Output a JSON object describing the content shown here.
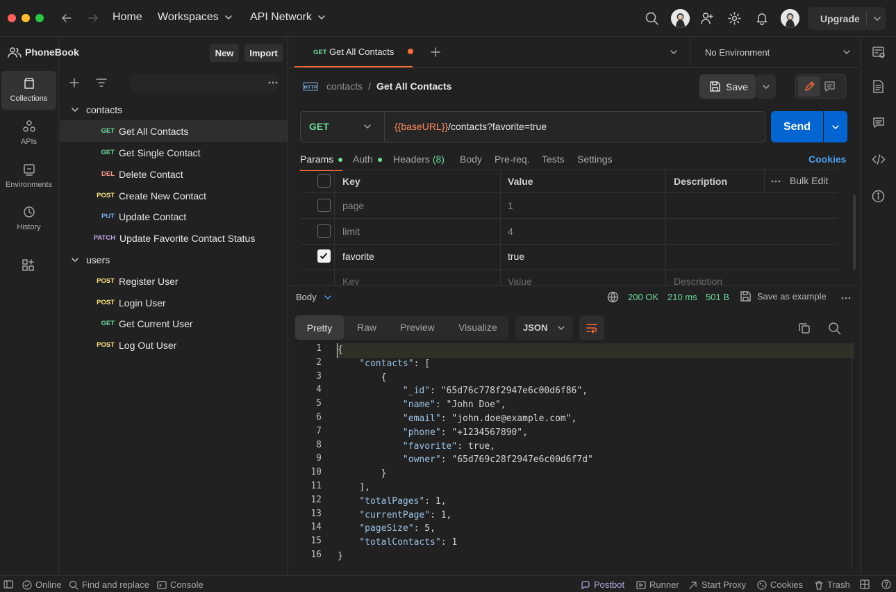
{
  "topbar": {
    "home": "Home",
    "workspaces": "Workspaces",
    "api_network": "API Network",
    "upgrade": "Upgrade"
  },
  "workspace": {
    "name": "PhoneBook",
    "new_label": "New",
    "import_label": "Import"
  },
  "rail": [
    {
      "label": "Collections",
      "icon": "collections-icon"
    },
    {
      "label": "APIs",
      "icon": "apis-icon"
    },
    {
      "label": "Environments",
      "icon": "environments-icon"
    },
    {
      "label": "History",
      "icon": "history-icon"
    }
  ],
  "tree": {
    "folders": [
      {
        "name": "contacts",
        "requests": [
          {
            "method": "GET",
            "name": "Get All Contacts"
          },
          {
            "method": "GET",
            "name": "Get Single Contact"
          },
          {
            "method": "DEL",
            "name": "Delete Contact"
          },
          {
            "method": "POST",
            "name": "Create New Contact"
          },
          {
            "method": "PUT",
            "name": "Update Contact"
          },
          {
            "method": "PATCH",
            "name": "Update Favorite Contact Status"
          }
        ]
      },
      {
        "name": "users",
        "requests": [
          {
            "method": "POST",
            "name": "Register User"
          },
          {
            "method": "POST",
            "name": "Login User"
          },
          {
            "method": "GET",
            "name": "Get Current User"
          },
          {
            "method": "POST",
            "name": "Log Out User"
          }
        ]
      }
    ]
  },
  "tab": {
    "method": "GET",
    "name": "Get All Contacts"
  },
  "environment": "No Environment",
  "breadcrumb": {
    "folder": "contacts",
    "sep": "/",
    "request": "Get All Contacts"
  },
  "save_label": "Save",
  "request": {
    "method": "GET",
    "url_var": "{{baseURL}}",
    "url_path": "/contacts?favorite=true",
    "send_label": "Send"
  },
  "param_tabs": {
    "params": "Params",
    "auth": "Auth",
    "headers": "Headers",
    "headers_count": "(8)",
    "body": "Body",
    "prereq": "Pre-req.",
    "tests": "Tests",
    "settings": "Settings",
    "cookies": "Cookies"
  },
  "params_table": {
    "headers": [
      "Key",
      "Value",
      "Description"
    ],
    "bulk_edit": "Bulk Edit",
    "rows": [
      {
        "key": "page",
        "value": "1",
        "checked": false
      },
      {
        "key": "limit",
        "value": "4",
        "checked": false
      },
      {
        "key": "favorite",
        "value": "true",
        "checked": true
      }
    ],
    "placeholder": {
      "key": "Key",
      "value": "Value",
      "description": "Description"
    }
  },
  "response": {
    "body_label": "Body",
    "status": "200 OK",
    "time": "210 ms",
    "size": "501 B",
    "save_example": "Save as example",
    "views": [
      "Pretty",
      "Raw",
      "Preview",
      "Visualize"
    ],
    "format": "JSON"
  },
  "code_lines": [
    "{",
    "    \"contacts\": [",
    "        {",
    "            \"_id\": \"65d76c778f2947e6c00d6f86\",",
    "            \"name\": \"John Doe\",",
    "            \"email\": \"john.doe@example.com\",",
    "            \"phone\": \"+1234567890\",",
    "            \"favorite\": true,",
    "            \"owner\": \"65d769c28f2947e6c00d6f7d\"",
    "        }",
    "    ],",
    "    \"totalPages\": 1,",
    "    \"currentPage\": 1,",
    "    \"pageSize\": 5,",
    "    \"totalContacts\": 1",
    "}"
  ],
  "statusbar": {
    "online": "Online",
    "find_replace": "Find and replace",
    "console": "Console",
    "postbot": "Postbot",
    "runner": "Runner",
    "proxy": "Start Proxy",
    "cookies": "Cookies",
    "trash": "Trash"
  },
  "colors": {
    "accent": "#0265d2",
    "get": "#6bdd9a",
    "post": "#ffe47e",
    "delete": "#f79a8e",
    "put": "#74aef6",
    "patch": "#c0a8e1",
    "status_ok": "#6bdd9a",
    "unsaved_dot": "#ff6c37"
  }
}
